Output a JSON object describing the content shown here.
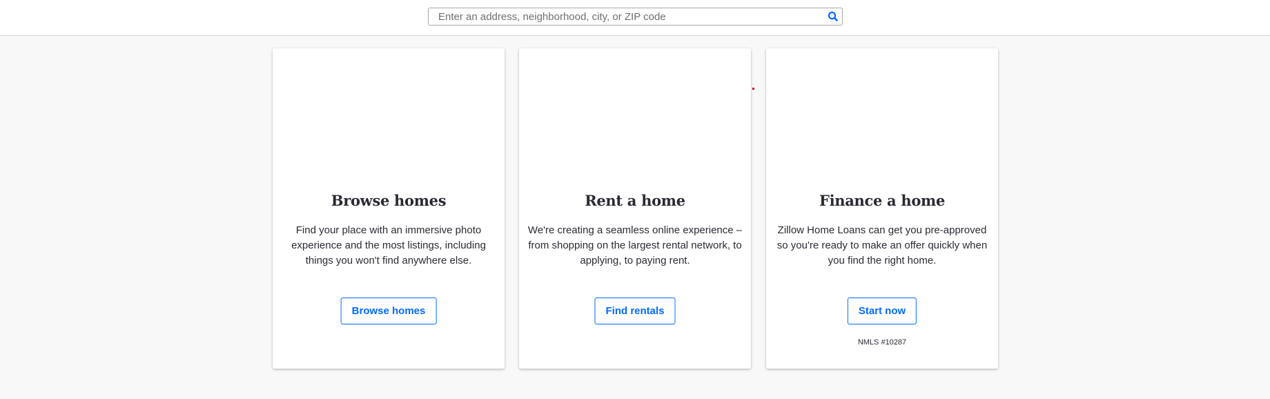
{
  "search": {
    "placeholder": "Enter an address, neighborhood, city, or ZIP code",
    "value": "",
    "icon": "search-icon"
  },
  "colors": {
    "accent": "#006aff",
    "page_background": "#f8f8f9",
    "text": "#2a2a33"
  },
  "cards": [
    {
      "title": "Browse homes",
      "description": "Find your place with an immersive photo experience and the most listings, including things you won't find anywhere else.",
      "button_label": "Browse homes"
    },
    {
      "title": "Rent a home",
      "description": "We're creating a seamless online experience – from shopping on the largest rental network, to applying, to paying rent.",
      "button_label": "Find rentals"
    },
    {
      "title": "Finance a home",
      "description": "Zillow Home Loans can get you pre-approved so you're ready to make an offer quickly when you find the right home.",
      "button_label": "Start now",
      "footnote": "NMLS #10287"
    }
  ]
}
